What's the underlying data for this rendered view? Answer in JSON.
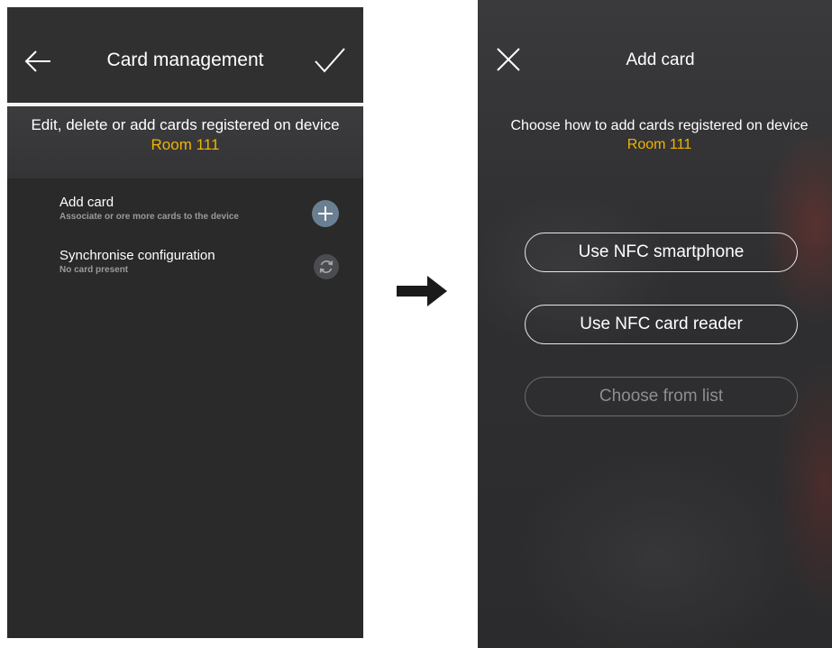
{
  "left_screen": {
    "header": {
      "title": "Card management",
      "back_icon": "arrow-left-icon",
      "confirm_icon": "checkmark-icon"
    },
    "info": {
      "text": "Edit, delete or add cards registered on device",
      "device_name": "Room 111"
    },
    "items": [
      {
        "title": "Add card",
        "subtitle": "Associate or ore more cards to the device",
        "icon": "plus-icon"
      },
      {
        "title": "Synchronise configuration",
        "subtitle": "No card present",
        "icon": "sync-icon"
      }
    ]
  },
  "transition": {
    "icon": "arrow-right-icon"
  },
  "right_screen": {
    "header": {
      "title": "Add card",
      "close_icon": "close-icon"
    },
    "info": {
      "text": "Choose how to add cards registered on device",
      "device_name": "Room 111"
    },
    "buttons": [
      {
        "label": "Use NFC smartphone",
        "enabled": true
      },
      {
        "label": "Use NFC card reader",
        "enabled": true
      },
      {
        "label": "Choose from list",
        "enabled": false
      }
    ]
  },
  "colors": {
    "accent": "#f0b400",
    "add_button": "#6a7f92",
    "sync_button": "#4a4c50",
    "background": "#2a2a2b"
  }
}
